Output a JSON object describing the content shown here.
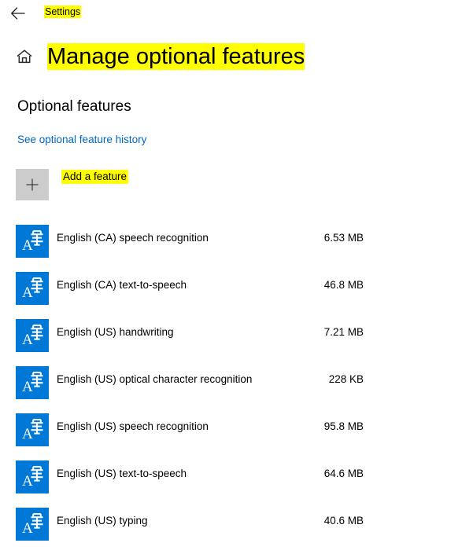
{
  "topbar": {
    "back_icon": "back-arrow-icon",
    "breadcrumb_label": "Settings"
  },
  "header": {
    "home_icon": "home-icon",
    "title": "Manage optional features"
  },
  "section": {
    "heading": "Optional features",
    "history_link": "See optional feature history"
  },
  "add_feature": {
    "plus_icon": "plus-icon",
    "label": "Add a feature"
  },
  "features": [
    {
      "icon": "language-pack-icon",
      "name": "English (CA) speech recognition",
      "size": "6.53 MB"
    },
    {
      "icon": "language-pack-icon",
      "name": "English (CA) text-to-speech",
      "size": "46.8 MB"
    },
    {
      "icon": "language-pack-icon",
      "name": "English (US) handwriting",
      "size": "7.21 MB"
    },
    {
      "icon": "language-pack-icon",
      "name": "English (US) optical character recognition",
      "size": "228 KB"
    },
    {
      "icon": "language-pack-icon",
      "name": "English (US) speech recognition",
      "size": "95.8 MB"
    },
    {
      "icon": "language-pack-icon",
      "name": "English (US) text-to-speech",
      "size": "64.6 MB"
    },
    {
      "icon": "language-pack-icon",
      "name": "English (US) typing",
      "size": "40.6 MB"
    }
  ],
  "colors": {
    "accent_blue": "#0078D7",
    "link_blue": "#0067C0",
    "highlight_yellow": "#FFFF00",
    "plus_box_gray": "#CCCCCC"
  }
}
